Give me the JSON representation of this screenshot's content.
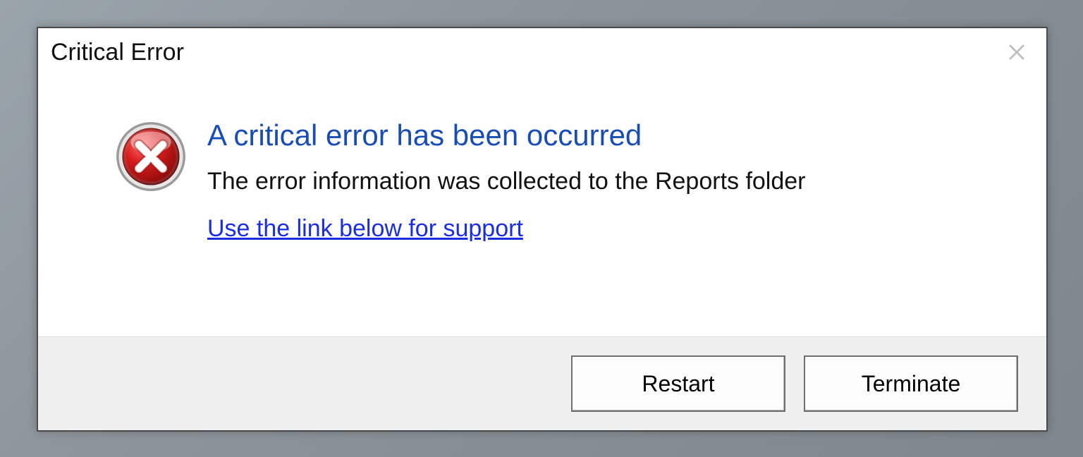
{
  "dialog": {
    "title": "Critical Error",
    "headline": "A critical error has been occurred",
    "subtext": "The error information was collected to the Reports folder",
    "support_link": "Use the link below for support",
    "buttons": {
      "restart": "Restart",
      "terminate": "Terminate"
    }
  }
}
